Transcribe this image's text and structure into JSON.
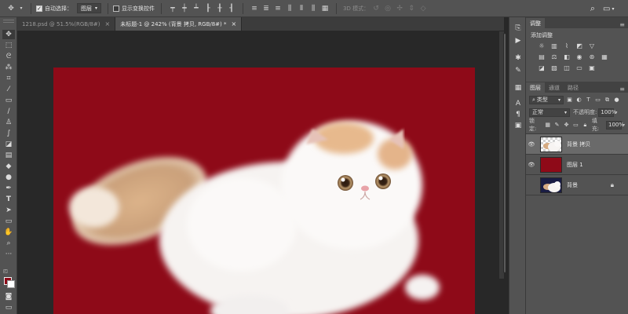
{
  "options_bar": {
    "auto_select_label": "自动选择：",
    "auto_select_value": "图层",
    "show_transform_label": "显示变换控件",
    "mode_3d_label": "3D 模式："
  },
  "doc_tabs": [
    {
      "label": "1218.psd @ 51.5%(RGB/8#)",
      "active": false
    },
    {
      "label": "未标题-1 @ 242% (背景 拷贝, RGB/8#) *",
      "active": true
    }
  ],
  "panels": {
    "adjustments": {
      "tab_label": "调整",
      "add_label": "添加调整"
    },
    "layers": {
      "tabs": [
        "图层",
        "通道",
        "路径"
      ],
      "filter_value": "类型",
      "blend_mode": "正常",
      "opacity_label": "不透明度:",
      "opacity_value": "100%",
      "lock_label": "锁定:",
      "fill_label": "填充:",
      "fill_value": "100%",
      "items": [
        {
          "name": "背景 拷贝",
          "visible": true,
          "active": true,
          "locked": false
        },
        {
          "name": "图层 1",
          "visible": true,
          "active": false,
          "locked": false
        },
        {
          "name": "背景",
          "visible": false,
          "active": false,
          "locked": true
        }
      ]
    }
  },
  "colors": {
    "canvas_fill": "#8e0a18",
    "foreground_swatch": "#8e0a18",
    "background_swatch": "#ffffff"
  }
}
